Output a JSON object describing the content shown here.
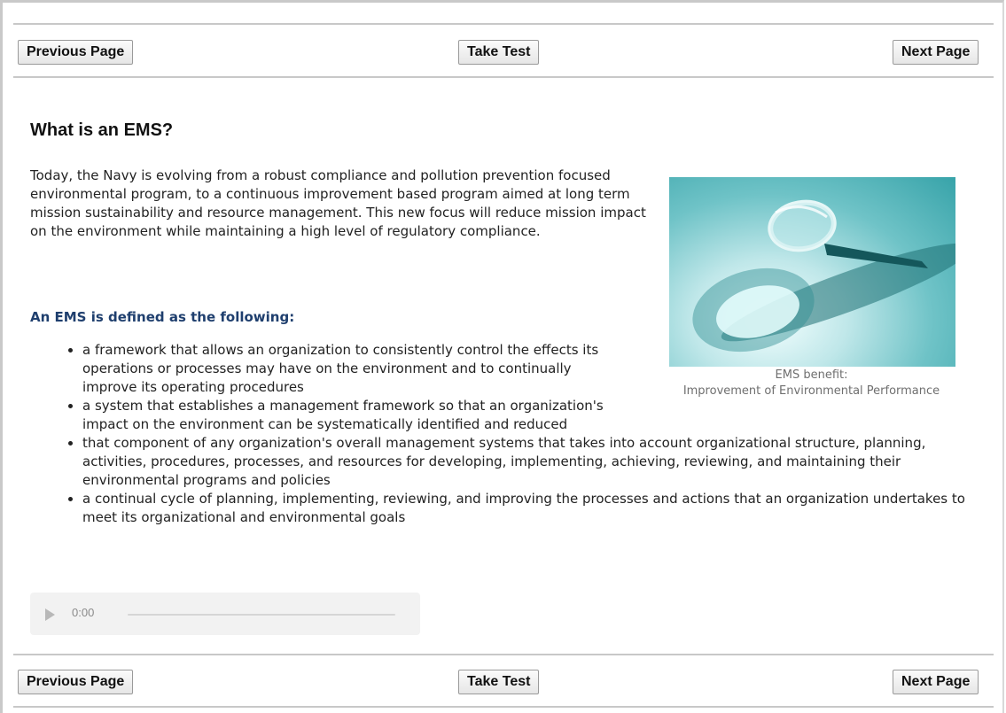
{
  "nav": {
    "previous_label": "Previous Page",
    "test_label": "Take Test",
    "next_label": "Next Page"
  },
  "content": {
    "title": "What is an EMS?",
    "intro": "Today, the Navy is evolving from a robust compliance and pollution prevention focused environmental program, to a continuous improvement based program aimed at long term mission sustainability and resource management. This new focus will reduce mission impact on the environment while maintaining a high level of regulatory compliance.",
    "definition_heading": "An EMS is defined as the following:",
    "definitions": [
      "a framework that allows an organization to consistently control the effects its operations or processes may have on the environment and to continually improve its operating procedures",
      "a system that establishes a management framework so that an organization's impact on the environment can be systematically identified and reduced",
      "that component of any organization's overall management systems that takes into account organizational structure, planning, activities, procedures, processes, and resources for developing, implementing, achieving, reviewing, and maintaining their environmental programs and policies",
      "a continual cycle of planning, implementing, reviewing, and improving the processes and actions that an organization undertakes to meet its organizational and environmental goals"
    ]
  },
  "figure": {
    "image": "magnifying-glass-photo",
    "caption_line1": "EMS benefit:",
    "caption_line2": "Improvement of Environmental Performance"
  },
  "audio": {
    "time": "0:00",
    "icon": "play-icon"
  }
}
